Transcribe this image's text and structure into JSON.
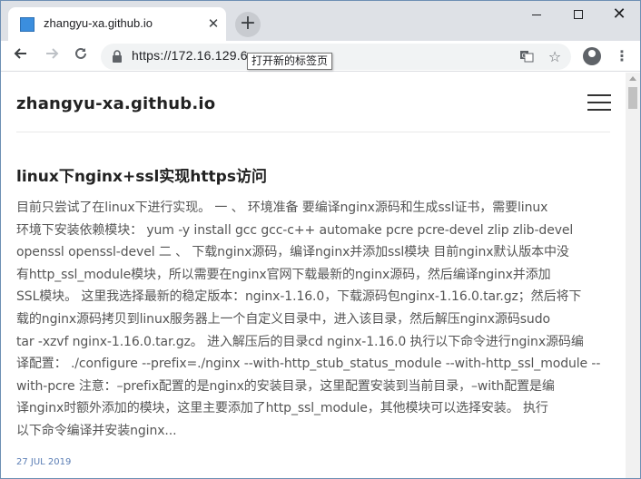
{
  "browser": {
    "tab_title": "zhangyu-xa.github.io",
    "tab_close": "✕",
    "new_tab": "+",
    "url": "https://172.16.129.6",
    "tooltip": "打开新的标签页",
    "window_close": "✕"
  },
  "site": {
    "title": "zhangyu-xa.github.io"
  },
  "post": {
    "title": "linux下nginx+ssl实现https访问",
    "excerpt_lines": [
      "目前只尝试了在linux下进行实现。 一 、 环境准备 要编译nginx源码和生成ssl证书，需要linux",
      "环境下安装依赖模块： yum -y install gcc gcc-c++ automake pcre pcre-devel zlip zlib-devel",
      "openssl openssl-devel 二 、 下载nginx源码，编译nginx并添加ssl模块 目前nginx默认版本中没",
      "有http_ssl_module模块，所以需要在nginx官网下载最新的nginx源码，然后编译nginx并添加",
      "SSL模块。 这里我选择最新的稳定版本：nginx-1.16.0，下载源码包nginx-1.16.0.tar.gz；然后将下",
      "载的nginx源码拷贝到linux服务器上一个自定义目录中，进入该目录，然后解压nginx源码sudo",
      "tar -xzvf nginx-1.16.0.tar.gz。 进入解压后的目录cd nginx-1.16.0 执行以下命令进行nginx源码编",
      "译配置： ./configure --prefix=./nginx --with-http_stub_status_module --with-http_ssl_module --",
      "with-pcre 注意：–prefix配置的是nginx的安装目录，这里配置安装到当前目录，–with配置是编",
      "译nginx时额外添加的模块，这里主要添加了http_ssl_module，其他模块可以选择安装。 执行",
      "以下命令编译并安装nginx..."
    ],
    "date": "27 JUL 2019"
  },
  "colors": {
    "accent_link": "#5a7db4",
    "tab_strip": "#dee1e6"
  }
}
